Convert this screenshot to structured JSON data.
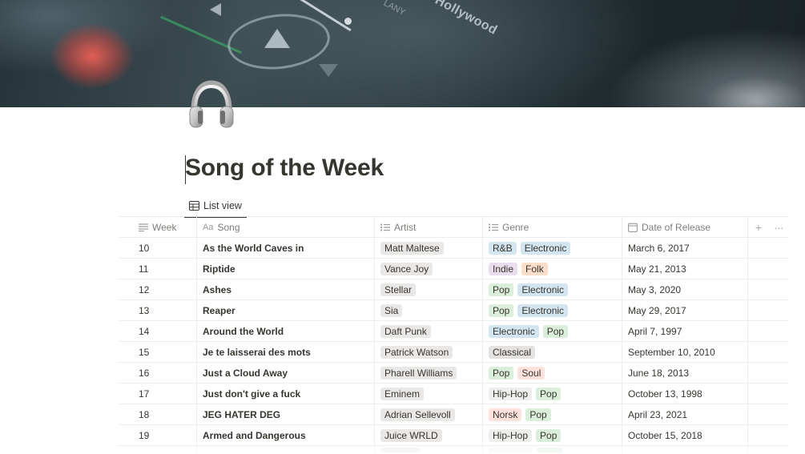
{
  "cover": {
    "text_main": "in Hollywood",
    "text_small": "LANY"
  },
  "page": {
    "icon": "headphones-icon",
    "title": "Song of the Week"
  },
  "view": {
    "tab_label": "List view"
  },
  "table": {
    "columns": {
      "week": "Week",
      "song": "Song",
      "artist": "Artist",
      "genre": "Genre",
      "date": "Date of Release"
    },
    "rows": [
      {
        "week": "10",
        "song": "As the World Caves in",
        "artist": "Matt Maltese",
        "genres": [
          "R&B",
          "Electronic"
        ],
        "date": "March 6, 2017"
      },
      {
        "week": "11",
        "song": "Riptide",
        "artist": "Vance Joy",
        "genres": [
          "Indie",
          "Folk"
        ],
        "date": "May 21, 2013"
      },
      {
        "week": "12",
        "song": "Ashes",
        "artist": "Stellar",
        "genres": [
          "Pop",
          "Electronic"
        ],
        "date": "May 3, 2020"
      },
      {
        "week": "13",
        "song": "Reaper",
        "artist": "Sia",
        "genres": [
          "Pop",
          "Electronic"
        ],
        "date": "May 29, 2017"
      },
      {
        "week": "14",
        "song": "Around the World",
        "artist": "Daft Punk",
        "genres": [
          "Electronic",
          "Pop"
        ],
        "date": "April 7, 1997"
      },
      {
        "week": "15",
        "song": "Je te laisserai des mots",
        "artist": "Patrick Watson",
        "genres": [
          "Classical"
        ],
        "date": "September 10, 2010"
      },
      {
        "week": "16",
        "song": "Just a Cloud Away",
        "artist": "Pharell Williams",
        "genres": [
          "Pop",
          "Soul"
        ],
        "date": "June 18, 2013"
      },
      {
        "week": "17",
        "song": "Just don't give a fuck",
        "artist": "Eminem",
        "genres": [
          "Hip-Hop",
          "Pop"
        ],
        "date": "October 13, 1998"
      },
      {
        "week": "18",
        "song": "JEG HATER DEG",
        "artist": "Adrian Sellevoll",
        "genres": [
          "Norsk",
          "Pop"
        ],
        "date": "April 23, 2021"
      },
      {
        "week": "19",
        "song": "Armed and Dangerous",
        "artist": "Juice WRLD",
        "genres": [
          "Hip-Hop",
          "Pop"
        ],
        "date": "October 15, 2018"
      }
    ]
  },
  "genre_colors": {
    "R&B": "#d3e5ef",
    "Electronic": "#d3e5ef",
    "Indie": "#e8deee",
    "Folk": "#fadec9",
    "Pop": "#dbeddb",
    "Classical": "#e3e2e0",
    "Soul": "#ffe2dd",
    "Hip-Hop": "#eeeeed",
    "Norsk": "#ffe2dd"
  }
}
